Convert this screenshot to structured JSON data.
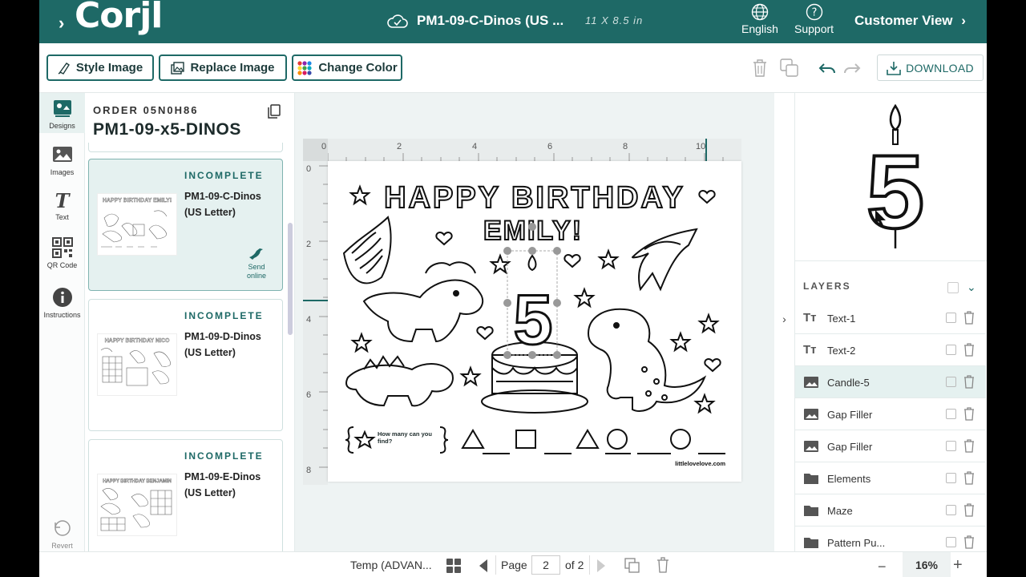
{
  "header": {
    "logo": "Corjl",
    "doc_title": "PM1-09-C-Dinos (US ...",
    "doc_size": "11 X 8.5 in",
    "language_label": "English",
    "support_label": "Support",
    "customer_view_label": "Customer View"
  },
  "toolbar": {
    "style_image": "Style Image",
    "replace_image": "Replace Image",
    "change_color": "Change Color",
    "download": "DOWNLOAD"
  },
  "rail": {
    "designs": "Designs",
    "images": "Images",
    "text": "Text",
    "qr": "QR Code",
    "instructions": "Instructions",
    "revert": "Revert"
  },
  "order": {
    "label": "ORDER",
    "number": "05N0H86",
    "name": "PM1-09-x5-DINOS"
  },
  "designs": [
    {
      "status": "INCOMPLETE",
      "name": "PM1-09-C-Dinos (US Letter)",
      "send": "Send online",
      "thumb_title": "HAPPY BIRTHDAY EMILY!"
    },
    {
      "status": "INCOMPLETE",
      "name": "PM1-09-D-Dinos (US Letter)",
      "thumb_title": "HAPPY BIRTHDAY NICO"
    },
    {
      "status": "INCOMPLETE",
      "name": "PM1-09-E-Dinos (US Letter)",
      "thumb_title": "HAPPY BIRTHDAY BENJAMIN"
    }
  ],
  "ruler": {
    "h": [
      "0",
      "2",
      "4",
      "6",
      "8",
      "10"
    ],
    "v": [
      "0",
      "2",
      "4",
      "6",
      "8"
    ]
  },
  "canvas": {
    "line1": "HAPPY BIRTHDAY",
    "line2": "EMILY!",
    "candle_number": "5",
    "find_text": "How many can you find?",
    "website": "littlelovelove.com"
  },
  "preview": {
    "number": "5"
  },
  "layers": {
    "header": "LAYERS",
    "items": [
      {
        "name": "Text-1",
        "icon": "text-icon"
      },
      {
        "name": "Text-2",
        "icon": "text-icon"
      },
      {
        "name": "Candle-5",
        "icon": "image-icon"
      },
      {
        "name": "Gap Filler",
        "icon": "image-icon"
      },
      {
        "name": "Gap Filler",
        "icon": "image-icon"
      },
      {
        "name": "Elements",
        "icon": "folder-icon"
      },
      {
        "name": "Maze",
        "icon": "folder-icon"
      },
      {
        "name": "Pattern Pu...",
        "icon": "folder-icon"
      }
    ]
  },
  "bottom": {
    "template": "Temp (ADVAN...",
    "page_label": "Page",
    "page_value": "2",
    "of_label": "of 2",
    "zoom": "16%"
  },
  "colors": {
    "brand": "#1e6966",
    "selected_bg": "#e5f1f0"
  }
}
